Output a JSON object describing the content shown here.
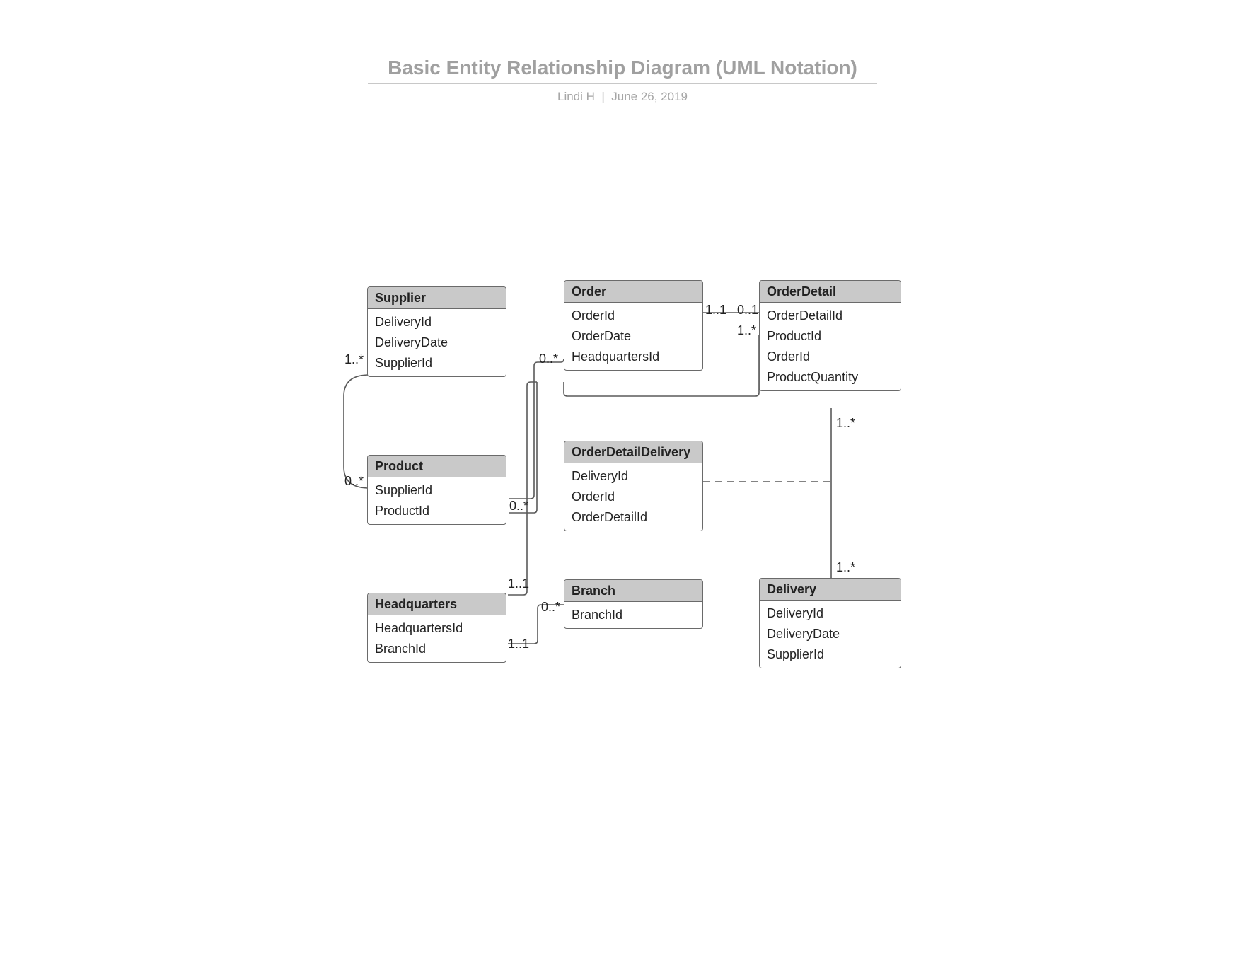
{
  "header": {
    "title": "Basic Entity Relationship Diagram (UML Notation)",
    "author": "Lindi H",
    "separator": "|",
    "date": "June 26, 2019"
  },
  "entities": {
    "supplier": {
      "name": "Supplier",
      "attrs": [
        "DeliveryId",
        "DeliveryDate",
        "SupplierId"
      ]
    },
    "order": {
      "name": "Order",
      "attrs": [
        "OrderId",
        "OrderDate",
        "HeadquartersId"
      ]
    },
    "orderdetail": {
      "name": "OrderDetail",
      "attrs": [
        "OrderDetailId",
        "ProductId",
        "OrderId",
        "ProductQuantity"
      ]
    },
    "product": {
      "name": "Product",
      "attrs": [
        "SupplierId",
        "ProductId"
      ]
    },
    "odd": {
      "name": "OrderDetailDelivery",
      "attrs": [
        "DeliveryId",
        "OrderId",
        "OrderDetailId"
      ]
    },
    "headquarters": {
      "name": "Headquarters",
      "attrs": [
        "HeadquartersId",
        "BranchId"
      ]
    },
    "branch": {
      "name": "Branch",
      "attrs": [
        "BranchId"
      ]
    },
    "delivery": {
      "name": "Delivery",
      "attrs": [
        "DeliveryId",
        "DeliveryDate",
        "SupplierId"
      ]
    }
  },
  "multiplicities": {
    "supplier_side": "1..*",
    "product_side": "0..*",
    "order_left": "0..*",
    "order_right": "1..1",
    "orderdetail_left": "0..1",
    "orderdetail_prod": "1..*",
    "product_right": "0..*",
    "hq_top": "1..1",
    "hq_branch": "1..1",
    "branch_left": "0..*",
    "od_del_top": "1..*",
    "od_del_bot": "1..*"
  },
  "relationships": [
    {
      "from": "Supplier",
      "to": "Product",
      "from_mult": "1..*",
      "to_mult": "0..*"
    },
    {
      "from": "Order",
      "to": "OrderDetail",
      "from_mult": "1..1",
      "to_mult": "0..1"
    },
    {
      "from": "Product",
      "to": "OrderDetail",
      "from_mult": "0..*",
      "to_mult": "1..*"
    },
    {
      "from": "Order",
      "to": "Product",
      "from_mult": "0..*",
      "to_mult": "0..*"
    },
    {
      "from": "Headquarters",
      "to": "Order",
      "from_mult": "1..1",
      "to_mult": ""
    },
    {
      "from": "Headquarters",
      "to": "Branch",
      "from_mult": "1..1",
      "to_mult": "0..*"
    },
    {
      "from": "OrderDetail",
      "to": "Delivery",
      "from_mult": "1..*",
      "to_mult": "1..*"
    },
    {
      "from": "OrderDetailDelivery",
      "to": "association(OrderDetail,Delivery)",
      "style": "dashed"
    }
  ]
}
